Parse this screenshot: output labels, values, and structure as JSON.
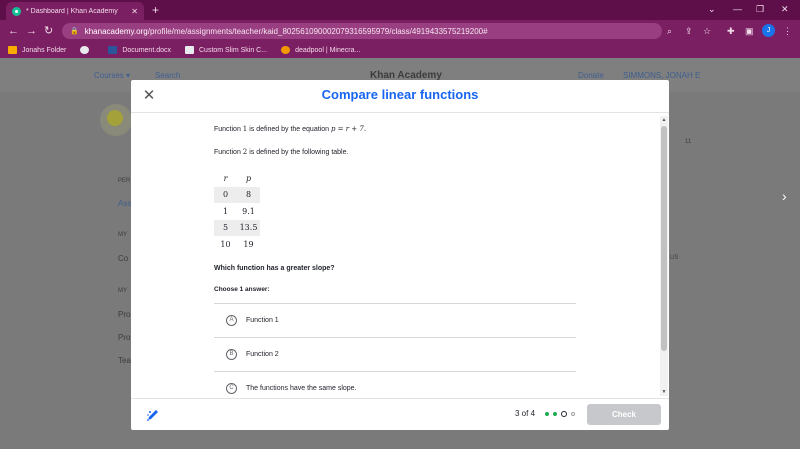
{
  "browser": {
    "tab_title": "* Dashboard | Khan Academy",
    "tab_close": "✕",
    "new_tab": "+",
    "window_controls": [
      "⌄",
      "—",
      "❐",
      "✕"
    ],
    "url_host": "khanacademy.org",
    "url_path": "/profile/me/assignments/teacher/kaid_802561090002079316595979/class/4919433575219200#",
    "profile_initial": "J",
    "bookmarks": [
      {
        "label": "Jonahs Folder",
        "color": "#f9ab00"
      },
      {
        "label": "",
        "color": "#e8eaed"
      },
      {
        "label": "Document.docx",
        "color": "#2b579a"
      },
      {
        "label": "Custom Slim Skin C...",
        "color": "#e8eaed"
      },
      {
        "label": "deadpool | Minecra...",
        "color": "#f29900"
      }
    ]
  },
  "background_page": {
    "courses": "Courses ▾",
    "search": "Search",
    "logo": "Khan Academy",
    "donate": "Donate",
    "user": "SIMMONS, JONAH E",
    "side_items": [
      "PER",
      "Ass",
      "MY",
      "Co",
      "MY",
      "Pro",
      "Pro",
      "Tea"
    ],
    "stat": "11",
    "sus": "US"
  },
  "modal": {
    "title": "Compare linear functions",
    "close": "✕",
    "function1_prefix": "Function ",
    "function1_num": "1",
    "function1_mid": " is defined by the equation ",
    "function1_eq": "p = r + 7.",
    "function2_prefix": "Function ",
    "function2_num": "2",
    "function2_suffix": " is defined by the following table.",
    "table": {
      "headers": [
        "r",
        "p"
      ],
      "rows": [
        [
          "0",
          "8"
        ],
        [
          "1",
          "9.1"
        ],
        [
          "5",
          "13.5"
        ],
        [
          "10",
          "19"
        ]
      ]
    },
    "question": "Which function has a greater slope?",
    "choose": "Choose 1 answer:",
    "choices": [
      {
        "letter": "A",
        "text": "Function 1"
      },
      {
        "letter": "B",
        "text": "Function 2"
      },
      {
        "letter": "C",
        "text": "The functions have the same slope."
      }
    ],
    "progress": "3 of 4",
    "check": "Check",
    "colors": {
      "title": "#1865f2",
      "done": "#1fab54"
    }
  }
}
